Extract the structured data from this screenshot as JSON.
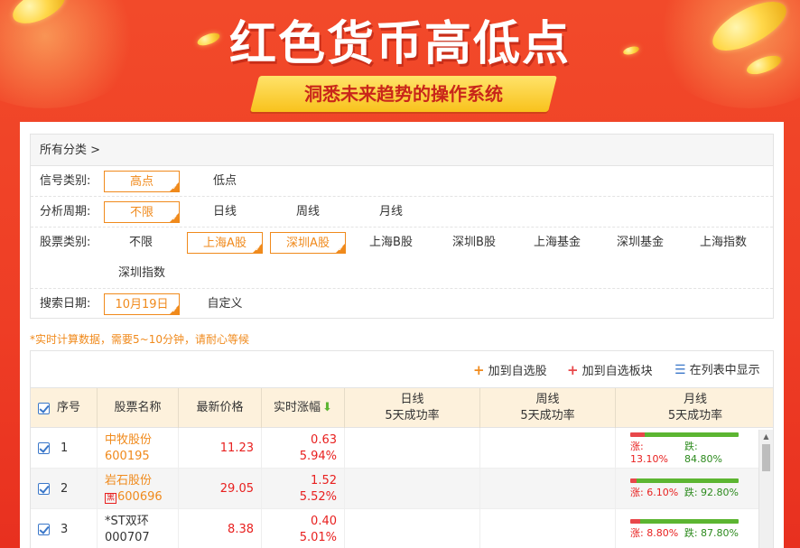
{
  "banner": {
    "title": "红色货币高低点",
    "subtitle": "洞悉未来趋势的操作系统"
  },
  "filters": {
    "breadcrumb": "所有分类 >",
    "signal": {
      "label": "信号类别:",
      "options": [
        "高点",
        "低点"
      ],
      "selected": "高点"
    },
    "period": {
      "label": "分析周期:",
      "options": [
        "不限",
        "日线",
        "周线",
        "月线"
      ],
      "selected": "不限"
    },
    "stock_type": {
      "label": "股票类别:",
      "options": [
        "不限",
        "上海A股",
        "深圳A股",
        "上海B股",
        "深圳B股",
        "上海基金",
        "深圳基金",
        "上海指数",
        "深圳指数"
      ],
      "selected": [
        "上海A股",
        "深圳A股"
      ]
    },
    "date": {
      "label": "搜索日期:",
      "options": [
        "10月19日",
        "自定义"
      ],
      "selected": "10月19日"
    }
  },
  "note": "*实时计算数据，需要5~10分钟，请耐心等候",
  "toolbar": {
    "add_watch": "加到自选股",
    "add_block": "加到自选板块",
    "show_list": "在列表中显示"
  },
  "table": {
    "headers": {
      "seq": "序号",
      "name": "股票名称",
      "price": "最新价格",
      "change": "实时涨幅",
      "day_1": "日线",
      "day_2": "5天成功率",
      "week_1": "周线",
      "week_2": "5天成功率",
      "month_1": "月线",
      "month_2": "5天成功率"
    },
    "rows": [
      {
        "seq": "1",
        "name": "中牧股份",
        "code": "600195",
        "price": "11.23",
        "change": "0.63",
        "pct": "5.94%",
        "rise": "涨: 13.10%",
        "fall": "跌: 84.80%",
        "rise_frac": 0.131,
        "fall_frac": 0.848
      },
      {
        "seq": "2",
        "name": "岩石股份",
        "code": "600696",
        "badge": "黑",
        "price": "29.05",
        "change": "1.52",
        "pct": "5.52%",
        "rise": "涨: 6.10%",
        "fall": "跌: 92.80%",
        "rise_frac": 0.061,
        "fall_frac": 0.928
      },
      {
        "seq": "3",
        "name": "*ST双环",
        "code": "000707",
        "price": "8.38",
        "change": "0.40",
        "pct": "5.01%",
        "rise": "涨: 8.80%",
        "fall": "跌: 87.80%",
        "rise_frac": 0.088,
        "fall_frac": 0.878
      }
    ]
  },
  "colors": {
    "accent": "#f08a1c",
    "red": "#e8201f",
    "green": "#5cb531",
    "banner": "#ee3d25"
  }
}
